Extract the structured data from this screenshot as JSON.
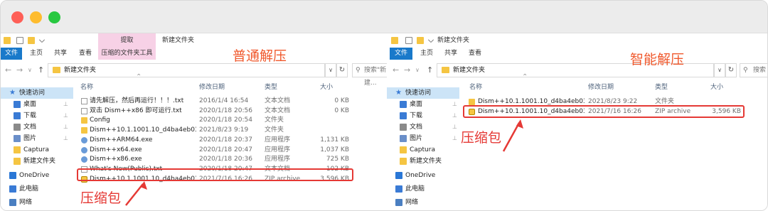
{
  "ribbon": {
    "ctx_group_label": "提取",
    "window_title": "新建文件夹",
    "tabs": {
      "file": "文件",
      "home": "主页",
      "share": "共享",
      "view": "查看"
    },
    "ctx_tab_label": "压缩的文件夹工具"
  },
  "nav": {
    "back": "←",
    "forward": "→",
    "dropdown": "∨",
    "up": "↑",
    "refresh": "↻"
  },
  "address": {
    "path": "新建文件夹",
    "dropdown": "∨"
  },
  "search": {
    "left_placeholder": "搜索\"新建...",
    "right_placeholder": "搜索"
  },
  "columns": {
    "name": "名称",
    "date": "修改日期",
    "type": "类型",
    "size": "大小"
  },
  "sidebar": {
    "items": [
      {
        "label": "快速访问",
        "icon": "star-icon"
      },
      {
        "label": "桌面",
        "icon": "desktop-icon"
      },
      {
        "label": "下载",
        "icon": "download-icon"
      },
      {
        "label": "文档",
        "icon": "document-icon"
      },
      {
        "label": "图片",
        "icon": "picture-icon"
      },
      {
        "label": "Captura",
        "icon": "folder-icon"
      },
      {
        "label": "新建文件夹",
        "icon": "folder-icon"
      },
      {
        "label": "OneDrive",
        "icon": "cloud-icon"
      },
      {
        "label": "此电脑",
        "icon": "computer-icon"
      },
      {
        "label": "网络",
        "icon": "network-icon"
      }
    ],
    "pin_glyph": "📌"
  },
  "left_files": [
    {
      "name": "请先解压，然后再运行！！！.txt",
      "date": "2016/1/4 16:54",
      "type": "文本文档",
      "size": "0 KB",
      "icon": "txt"
    },
    {
      "name": "双击 Dism++x86 即可运行.txt",
      "date": "2020/1/18 20:56",
      "type": "文本文档",
      "size": "0 KB",
      "icon": "txt"
    },
    {
      "name": "Config",
      "date": "2020/1/18 20:54",
      "type": "文件夹",
      "size": "",
      "icon": "fold"
    },
    {
      "name": "Dism++10.1.1001.10_d4ba4eb03525...",
      "date": "2021/8/23 9:19",
      "type": "文件夹",
      "size": "",
      "icon": "fold"
    },
    {
      "name": "Dism++ARM64.exe",
      "date": "2020/1/18 20:37",
      "type": "应用程序",
      "size": "1,131 KB",
      "icon": "exe"
    },
    {
      "name": "Dism++x64.exe",
      "date": "2020/1/18 20:47",
      "type": "应用程序",
      "size": "1,037 KB",
      "icon": "exe"
    },
    {
      "name": "Dism++x86.exe",
      "date": "2020/1/18 20:36",
      "type": "应用程序",
      "size": "725 KB",
      "icon": "exe"
    },
    {
      "name": "What's New(Public).txt",
      "date": "2020/1/18 20:47",
      "type": "文本文档",
      "size": "102 KB",
      "icon": "txt"
    },
    {
      "name": "Dism++10.1.1001.10_d4ba4eb03525...",
      "date": "2021/7/16 16:26",
      "type": "ZIP archive",
      "size": "3,596 KB",
      "icon": "zip"
    }
  ],
  "right_files": [
    {
      "name": "Dism++10.1.1001.10_d4ba4eb03525...",
      "date": "2021/8/23 9:22",
      "type": "文件夹",
      "size": "",
      "icon": "fold"
    },
    {
      "name": "Dism++10.1.1001.10_d4ba4eb03525...",
      "date": "2021/7/16 16:26",
      "type": "ZIP archive",
      "size": "3,596 KB",
      "icon": "zip"
    }
  ],
  "annotations": {
    "left_title": "普通解压",
    "right_title": "智能解压",
    "zip_label": "压缩包"
  },
  "colors": {
    "accent": "#1979ca",
    "highlight": "#e53935",
    "annotation_title": "#f0592d",
    "ctx_tab": "#f7d1e6"
  }
}
